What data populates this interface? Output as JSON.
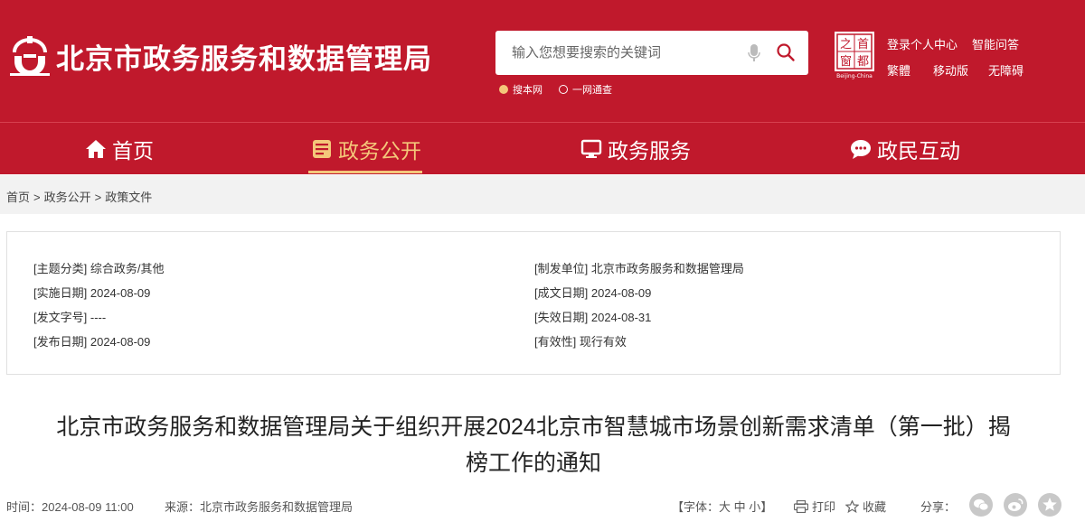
{
  "header": {
    "site_title": "北京市政务服务和数据管理局",
    "search_placeholder": "输入您想要搜索的关键词",
    "scope_options": [
      {
        "label": "搜本网",
        "selected": true
      },
      {
        "label": "一网通查",
        "selected": false
      }
    ],
    "capital_logo": {
      "chars": [
        "之",
        "首",
        "窗",
        "都"
      ],
      "caption": "Beijing-China"
    },
    "links_row1": [
      "登录个人中心",
      "智能问答"
    ],
    "links_row2": [
      "繁體",
      "移动版",
      "无障碍"
    ]
  },
  "nav": {
    "items": [
      {
        "label": "首页",
        "icon": "home-icon",
        "active": false
      },
      {
        "label": "政务公开",
        "icon": "document-icon",
        "active": true
      },
      {
        "label": "政务服务",
        "icon": "monitor-icon",
        "active": false
      },
      {
        "label": "政民互动",
        "icon": "chat-icon",
        "active": false
      }
    ]
  },
  "breadcrumb": [
    "首页",
    "政务公开",
    "政策文件"
  ],
  "info": {
    "left": [
      {
        "key": "[主题分类]",
        "value": "综合政务/其他"
      },
      {
        "key": "[实施日期]",
        "value": "2024-08-09"
      },
      {
        "key": "[发文字号]",
        "value": "----"
      },
      {
        "key": "[发布日期]",
        "value": "2024-08-09"
      }
    ],
    "right": [
      {
        "key": "[制发单位]",
        "value": "北京市政务服务和数据管理局"
      },
      {
        "key": "[成文日期]",
        "value": "2024-08-09"
      },
      {
        "key": "[失效日期]",
        "value": "2024-08-31"
      },
      {
        "key": "[有效性]",
        "value": "现行有效"
      }
    ]
  },
  "document": {
    "title_line1": "北京市政务服务和数据管理局关于组织开展2024北京市智慧城市场景创新需求清单（第一批）揭",
    "title_line2": "榜工作的通知",
    "time_label": "时间：",
    "time_value": "2024-08-09 11:00",
    "source_label": "来源：",
    "source_value": "北京市政务服务和数据管理局",
    "font_label": "【字体：",
    "font_sizes": [
      "大",
      "中",
      "小"
    ],
    "font_close": "】",
    "print_label": "打印",
    "favorite_label": "收藏",
    "share_label": "分享："
  },
  "colors": {
    "brand": "#c0192c",
    "accent": "#f4c77a"
  }
}
